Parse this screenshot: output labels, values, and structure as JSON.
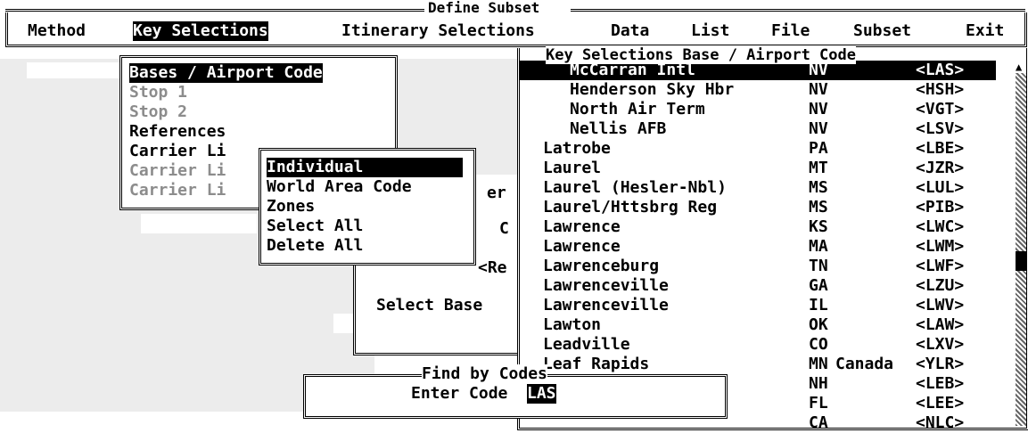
{
  "window": {
    "title": "Define Subset"
  },
  "menu": [
    {
      "label": "Method",
      "selected": false
    },
    {
      "label": "Key Selections",
      "selected": true
    },
    {
      "label": "Itinerary Selections",
      "selected": false
    },
    {
      "label": "Data",
      "selected": false
    },
    {
      "label": "List",
      "selected": false
    },
    {
      "label": "File",
      "selected": false
    },
    {
      "label": "Subset",
      "selected": false
    },
    {
      "label": "Exit",
      "selected": false
    }
  ],
  "key_selections_menu": [
    {
      "label": "Bases / Airport Code",
      "enabled": true,
      "selected": true
    },
    {
      "label": "Stop 1",
      "enabled": false
    },
    {
      "label": "Stop 2",
      "enabled": false
    },
    {
      "label": "References",
      "enabled": true
    },
    {
      "label": "Carrier Li",
      "enabled": true
    },
    {
      "label": "Carrier Li",
      "enabled": false
    },
    {
      "label": "Carrier Li",
      "enabled": false
    }
  ],
  "submenu": [
    {
      "label": "Individual",
      "selected": true
    },
    {
      "label": "World Area Code",
      "selected": false
    },
    {
      "label": "Zones",
      "selected": false
    },
    {
      "label": "Select All",
      "selected": false
    },
    {
      "label": "Delete All",
      "selected": false
    }
  ],
  "background_fragments": {
    "er": "er",
    "c": "C",
    "re": "<Re",
    "select_base": "Select Base"
  },
  "airport_list": {
    "title": "Key Selections Base / Airport Code",
    "rows": [
      {
        "name": "McCarran Intl",
        "state": "NV",
        "country": "",
        "code": "<LAS>",
        "indent": true,
        "selected": true
      },
      {
        "name": "Henderson Sky Hbr",
        "state": "NV",
        "country": "",
        "code": "<HSH>",
        "indent": true
      },
      {
        "name": "North Air Term",
        "state": "NV",
        "country": "",
        "code": "<VGT>",
        "indent": true
      },
      {
        "name": "Nellis AFB",
        "state": "NV",
        "country": "",
        "code": "<LSV>",
        "indent": true
      },
      {
        "name": "Latrobe",
        "state": "PA",
        "country": "",
        "code": "<LBE>"
      },
      {
        "name": "Laurel",
        "state": "MT",
        "country": "",
        "code": "<JZR>"
      },
      {
        "name": "Laurel (Hesler-Nbl)",
        "state": "MS",
        "country": "",
        "code": "<LUL>"
      },
      {
        "name": "Laurel/Httsbrg Reg",
        "state": "MS",
        "country": "",
        "code": "<PIB>"
      },
      {
        "name": "Lawrence",
        "state": "KS",
        "country": "",
        "code": "<LWC>"
      },
      {
        "name": "Lawrence",
        "state": "MA",
        "country": "",
        "code": "<LWM>"
      },
      {
        "name": "Lawrenceburg",
        "state": "TN",
        "country": "",
        "code": "<LWF>"
      },
      {
        "name": "Lawrenceville",
        "state": "GA",
        "country": "",
        "code": "<LZU>"
      },
      {
        "name": "Lawrenceville",
        "state": "IL",
        "country": "",
        "code": "<LWV>"
      },
      {
        "name": "Lawton",
        "state": "OK",
        "country": "",
        "code": "<LAW>"
      },
      {
        "name": "Leadville",
        "state": "CO",
        "country": "",
        "code": "<LXV>"
      },
      {
        "name": "Leaf Rapids",
        "state": "MN",
        "country": "Canada",
        "code": "<YLR>"
      },
      {
        "name": "",
        "state": "NH",
        "country": "",
        "code": "<LEB>"
      },
      {
        "name": "",
        "state": "FL",
        "country": "",
        "code": "<LEE>"
      },
      {
        "name": "",
        "state": "CA",
        "country": "",
        "code": "<NLC>"
      }
    ]
  },
  "find_by_codes": {
    "title": "Find by Codes",
    "label": "Enter Code",
    "value": "LAS"
  }
}
